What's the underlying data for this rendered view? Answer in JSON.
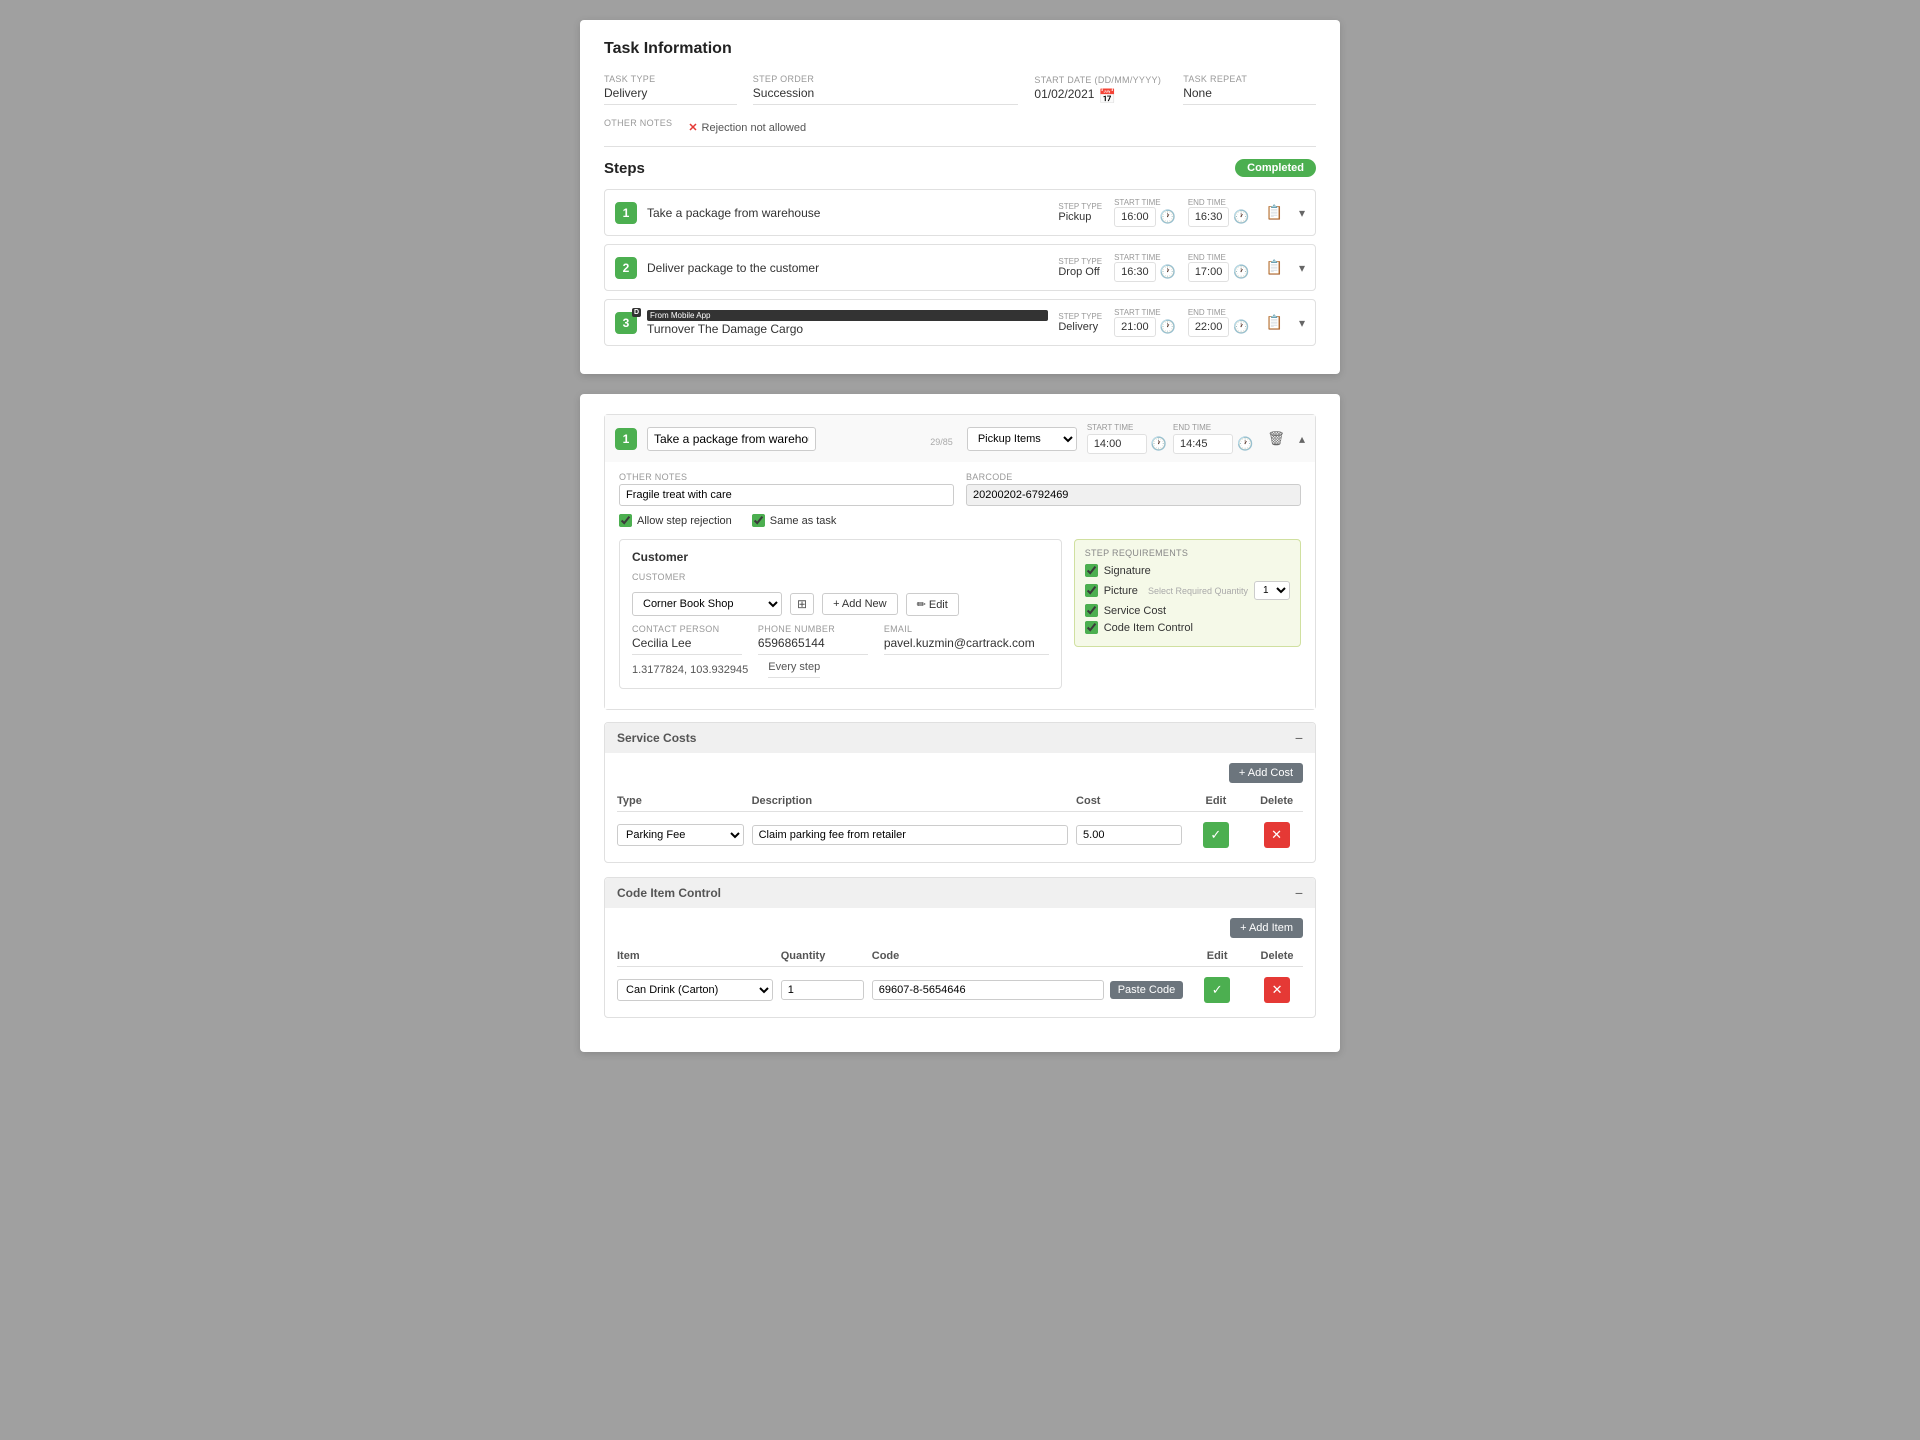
{
  "card1": {
    "title": "Task Information",
    "task_type_label": "TASK TYPE",
    "task_type_value": "Delivery",
    "step_order_label": "STEP ORDER",
    "step_order_value": "Succession",
    "start_date_label": "START DATE (DD/MM/YYYY)",
    "start_date_value": "01/02/2021",
    "task_repeat_label": "TASK REPEAT",
    "task_repeat_value": "None",
    "other_notes_label": "OTHER NOTES",
    "rejection_note": "Rejection not allowed",
    "steps_title": "Steps",
    "completed_badge": "Completed",
    "steps": [
      {
        "num": "1",
        "name": "Take a package from warehouse",
        "step_type_label": "STEP TYPE",
        "step_type_value": "Pickup",
        "start_time_label": "START TIME",
        "start_time_value": "16:00",
        "end_time_label": "END TIME",
        "end_time_value": "16:30",
        "has_badge": false
      },
      {
        "num": "2",
        "name": "Deliver package to the customer",
        "step_type_label": "STEP TYPE",
        "step_type_value": "Drop Off",
        "start_time_label": "START TIME",
        "start_time_value": "16:30",
        "end_time_label": "END TIME",
        "end_time_value": "17:00",
        "has_badge": false
      },
      {
        "num": "3",
        "name": "Turnover The Damage Cargo",
        "from_mobile": "From Mobile App",
        "step_type_label": "STEP TYPE",
        "step_type_value": "Delivery",
        "start_time_label": "START TIME",
        "start_time_value": "21:00",
        "end_time_label": "END TIME",
        "end_time_value": "22:00",
        "has_badge": true
      }
    ]
  },
  "card2": {
    "step_num": "1",
    "step_name": "Take a package from warehouse",
    "char_count": "29/85",
    "step_type_value": "Pickup Items",
    "start_time_value": "14:00",
    "end_time_value": "14:45",
    "other_notes_label": "OTHER NOTES",
    "other_notes_value": "Fragile treat with care",
    "barcode_label": "BARCODE",
    "barcode_value": "20200202-6792469",
    "allow_rejection_label": "Allow step rejection",
    "same_as_task_label": "Same as task",
    "customer_section_title": "Customer",
    "customer_label": "CUSTOMER",
    "customer_value": "Corner Book Shop",
    "contact_person_label": "CONTACT PERSON",
    "contact_person_value": "Cecilia Lee",
    "phone_number_label": "PHONE NUMBER",
    "phone_number_value": "6596865144",
    "email_label": "EMAIL",
    "email_value": "pavel.kuzmin@cartrack.com",
    "coords_value": "1.3177824, 103.932945",
    "every_step_label": "Every step",
    "add_new_btn": "+ Add New",
    "edit_btn": "✏ Edit",
    "requirements_label": "STEP REQUIREMENTS",
    "requirements": [
      {
        "label": "Signature",
        "checked": true
      },
      {
        "label": "Picture",
        "checked": true,
        "has_qty": true,
        "qty_placeholder": "Select Required Quantity",
        "qty_value": "1"
      },
      {
        "label": "Service Cost",
        "checked": true
      },
      {
        "label": "Code Item Control",
        "checked": true
      }
    ],
    "service_costs": {
      "title": "Service Costs",
      "add_cost_btn": "+ Add Cost",
      "columns": [
        "Type",
        "Description",
        "Cost",
        "Edit",
        "Delete"
      ],
      "rows": [
        {
          "type": "Parking Fee",
          "description": "Claim parking fee from retailer",
          "cost": "5.00"
        }
      ]
    },
    "code_item_control": {
      "title": "Code Item Control",
      "add_item_btn": "+ Add Item",
      "columns": [
        "Item",
        "Quantity",
        "Code",
        "Edit",
        "Delete"
      ],
      "rows": [
        {
          "item": "Can Drink (Carton)",
          "quantity": "1",
          "code": "69607-8-5654646"
        }
      ]
    }
  }
}
